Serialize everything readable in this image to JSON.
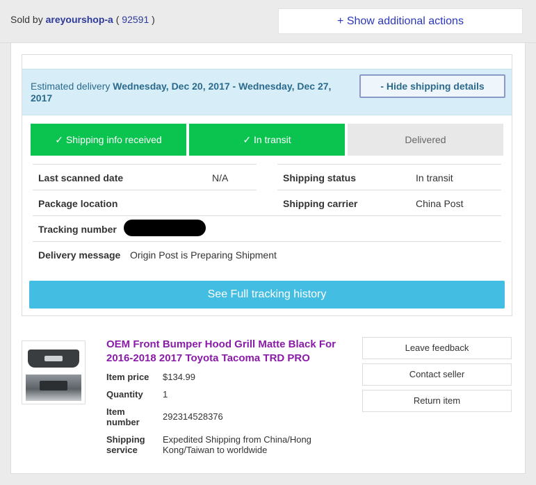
{
  "seller": {
    "prefix": "Sold by",
    "name": "areyourshop-a",
    "feedback_open": "(",
    "feedback_score": "92591",
    "feedback_close": ")"
  },
  "actions": {
    "show_additional": "+ Show additional actions"
  },
  "delivery": {
    "estimated_label": "Estimated delivery",
    "estimated_range": "Wednesday, Dec 20, 2017 - Wednesday, Dec 27, 2017",
    "hide_button": "- Hide shipping details"
  },
  "steps": [
    {
      "label": "✓ Shipping info received",
      "state": "done"
    },
    {
      "label": "✓ In transit",
      "state": "done"
    },
    {
      "label": "Delivered",
      "state": "pending"
    }
  ],
  "details": {
    "last_scanned_label": "Last scanned date",
    "last_scanned_value": "N/A",
    "shipping_status_label": "Shipping status",
    "shipping_status_value": "In transit",
    "package_location_label": "Package location",
    "shipping_carrier_label": "Shipping carrier",
    "shipping_carrier_value": "China Post",
    "tracking_number_label": "Tracking number",
    "delivery_message_label": "Delivery message",
    "delivery_message_value": "Origin Post is Preparing Shipment"
  },
  "tracking_button": "See Full tracking history",
  "item": {
    "title": "OEM Front Bumper Hood Grill Matte Black For 2016-2018 2017 Toyota Tacoma TRD PRO",
    "price_label": "Item price",
    "price_value": "$134.99",
    "quantity_label": "Quantity",
    "quantity_value": "1",
    "number_label": "Item number",
    "number_value": "292314528376",
    "service_label": "Shipping service",
    "service_value": "Expedited Shipping from China/Hong Kong/Taiwan to worldwide"
  },
  "item_actions": {
    "leave_feedback": "Leave feedback",
    "contact_seller": "Contact seller",
    "return_item": "Return item"
  },
  "colors": {
    "step_done": "#0ac44f",
    "step_pending": "#e8e8e8",
    "tracking_button": "#44bde3",
    "estimate_bg": "#d7edf7",
    "title": "#8a1aa8",
    "seller_link": "#2d3a9a"
  }
}
